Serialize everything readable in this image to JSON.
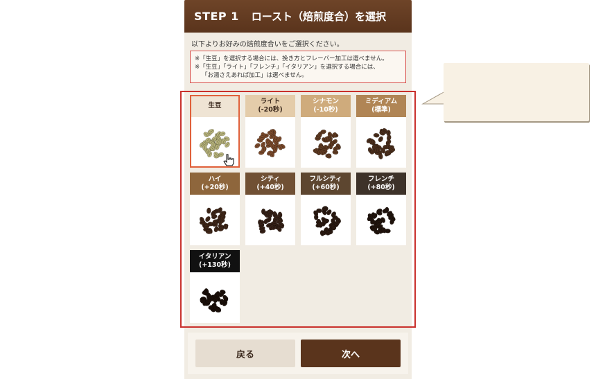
{
  "header": {
    "step": "STEP 1",
    "title": "ロースト（焙煎度合）を選択"
  },
  "instruction": "以下よりお好みの焙煎度合いをご選択ください。",
  "notes": [
    "※「生豆」を選択する場合には、挽き方とフレーバー加工は選べません。",
    "※「生豆」「ライト」「フレンチ」「イタリアン」を選択する場合には、",
    "「お湯さえあれば加工」は選べません。"
  ],
  "roasts": [
    {
      "line1": "生豆",
      "line2": "",
      "label_bg": "#efe4d4",
      "label_color": "#3c2a1e",
      "bean": "#b5b17a",
      "selected": true
    },
    {
      "line1": "ライト",
      "line2": "(-20秒)",
      "label_bg": "#e4ccaa",
      "label_color": "#3c2a1e",
      "bean": "#7a4a2c",
      "selected": false
    },
    {
      "line1": "シナモン",
      "line2": "(-10秒)",
      "label_bg": "#cfab7c",
      "label_color": "#ffffff",
      "bean": "#5e3a22",
      "selected": false
    },
    {
      "line1": "ミディアム",
      "line2": "(標準)",
      "label_bg": "#b08555",
      "label_color": "#ffffff",
      "bean": "#4a2e1c",
      "selected": false
    },
    {
      "line1": "ハイ",
      "line2": "(+20秒)",
      "label_bg": "#8e663c",
      "label_color": "#ffffff",
      "bean": "#3e2618",
      "selected": false
    },
    {
      "line1": "シティ",
      "line2": "(+40秒)",
      "label_bg": "#705034",
      "label_color": "#ffffff",
      "bean": "#352016",
      "selected": false
    },
    {
      "line1": "フルシティ",
      "line2": "(+60秒)",
      "label_bg": "#5d4630",
      "label_color": "#ffffff",
      "bean": "#2b1a11",
      "selected": false
    },
    {
      "line1": "フレンチ",
      "line2": "(+80秒)",
      "label_bg": "#3d3229",
      "label_color": "#ffffff",
      "bean": "#21140d",
      "selected": false
    },
    {
      "line1": "イタリアン",
      "line2": "(+130秒)",
      "label_bg": "#111111",
      "label_color": "#ffffff",
      "bean": "#1a0f09",
      "selected": false
    }
  ],
  "buttons": {
    "back": "戻る",
    "next": "次へ"
  },
  "colors": {
    "header": "#5a341c",
    "highlight": "#c9302c",
    "next_button": "#5a341c"
  }
}
